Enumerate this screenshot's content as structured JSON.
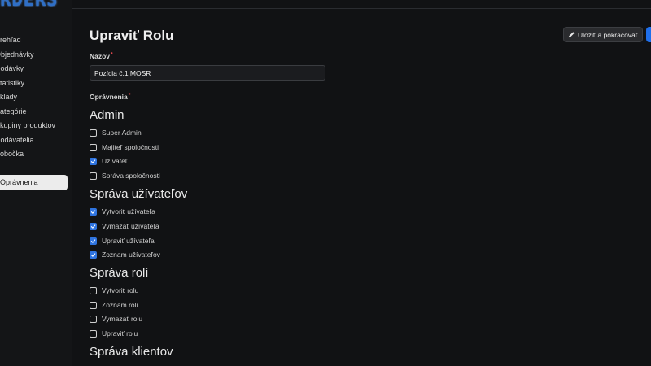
{
  "app": {
    "logo_text": "ORDERS"
  },
  "sidebar": {
    "items": [
      {
        "label": "Prehľad"
      },
      {
        "label": "Objednávky"
      },
      {
        "label": "Dodávky"
      },
      {
        "label": "Štatistiky"
      },
      {
        "label": "Sklady"
      },
      {
        "label": "Kategórie"
      },
      {
        "label": "Skupiny produktov"
      },
      {
        "label": "Dodávatelia"
      },
      {
        "label": "Pobočka"
      },
      {
        "label": "Oprávnenia"
      }
    ]
  },
  "page": {
    "title": "Upraviť Rolu",
    "save_continue_label": "Uložiť a pokračovať"
  },
  "form": {
    "name_label": "Názov",
    "name_value": "Pozícia č.1 MOSR",
    "permissions_label": "Oprávnenia",
    "required_mark": "*"
  },
  "groups": [
    {
      "title": "Admin",
      "items": [
        {
          "label": "Super Admin",
          "checked": false
        },
        {
          "label": "Majiteľ spoločnosti",
          "checked": false
        },
        {
          "label": "Užívateľ",
          "checked": true
        },
        {
          "label": "Správa spoločnosti",
          "checked": false
        }
      ]
    },
    {
      "title": "Správa užívateľov",
      "items": [
        {
          "label": "Vytvoriť užívateľa",
          "checked": true
        },
        {
          "label": "Vymazať užívateľa",
          "checked": true
        },
        {
          "label": "Upraviť užívateľa",
          "checked": true
        },
        {
          "label": "Zoznam užívateľov",
          "checked": true
        }
      ]
    },
    {
      "title": "Správa rolí",
      "items": [
        {
          "label": "Vytvoriť rolu",
          "checked": false
        },
        {
          "label": "Zoznam rolí",
          "checked": false
        },
        {
          "label": "Vymazať rolu",
          "checked": false
        },
        {
          "label": "Upraviť rolu",
          "checked": false
        }
      ]
    },
    {
      "title": "Správa klientov",
      "items": []
    }
  ],
  "colors": {
    "accent": "#2f74e0",
    "primary_button": "#1f6feb",
    "required": "#e5484d"
  }
}
